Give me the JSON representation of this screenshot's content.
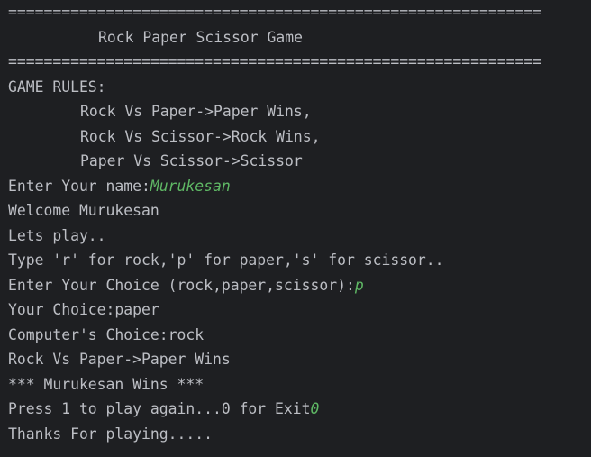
{
  "console": {
    "separator_top": "============================================================",
    "title": "Rock Paper Scissor Game",
    "separator_bottom": "============================================================",
    "rules_header": "GAME RULES:",
    "rules": [
      "Rock Vs Paper->Paper Wins,",
      "Rock Vs Scissor->Rock Wins,",
      "Paper Vs Scissor->Scissor"
    ],
    "name_prompt": "Enter Your name:",
    "name_input": "Murukesan",
    "welcome": "Welcome Murukesan",
    "lets_play": "Lets play..",
    "instructions": "Type 'r' for rock,'p' for paper,'s' for scissor..",
    "choice_prompt": "Enter Your Choice (rock,paper,scissor):",
    "choice_input": "p",
    "your_choice": "Your Choice:paper",
    "computer_choice": "Computer's Choice:rock",
    "result_rule": "Rock Vs Paper->Paper Wins",
    "winner": "*** Murukesan Wins ***",
    "replay_prompt": "Press 1 to play again...0 for Exit",
    "replay_input": "0",
    "thanks": "Thanks For playing....."
  },
  "colors": {
    "background": "#1e1f22",
    "text": "#bcbec4",
    "user_input": "#5fb865"
  }
}
